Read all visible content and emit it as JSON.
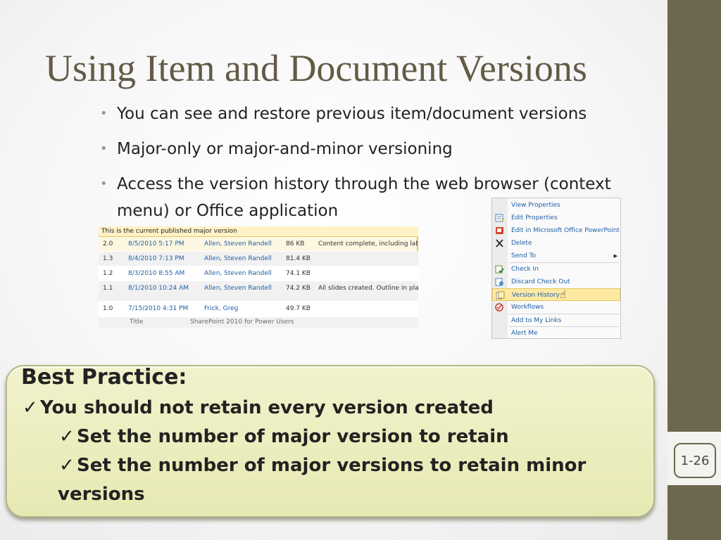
{
  "slide": {
    "title": "Using Item and Document Versions",
    "page_number": "1-26"
  },
  "bullets": [
    {
      "text": "You can see and restore previous item/document versions"
    },
    {
      "text": "Major-only or major-and-minor versioning"
    },
    {
      "text": "Access the version history through the web browser (context menu) or Office application"
    }
  ],
  "version_history": {
    "header": "This is the current published major version",
    "rows": [
      {
        "no": "2.0",
        "modified": "8/5/2010 5:17 PM",
        "modified_by": "Allen, Steven Randell",
        "size": "86 KB",
        "comments": "Content complete, including lab."
      },
      {
        "no": "1.3",
        "modified": "8/4/2010 7:13 PM",
        "modified_by": "Allen, Steven Randell",
        "size": "81.4 KB",
        "comments": ""
      },
      {
        "no": "1.2",
        "modified": "8/3/2010 8:55 AM",
        "modified_by": "Allen, Steven Randell",
        "size": "74.1 KB",
        "comments": ""
      },
      {
        "no": "1.1",
        "modified": "8/1/2010 10:24 AM",
        "modified_by": "Allen, Steven Randell",
        "size": "74.2 KB",
        "comments": "All slides created. Outline in place"
      },
      {
        "no": "1.0",
        "modified": "7/15/2010 4:31 PM",
        "modified_by": "Frick, Greg",
        "size": "49.7 KB",
        "comments": ""
      }
    ],
    "meta_label": "Title",
    "meta_value": "SharePoint 2010 for Power Users"
  },
  "context_menu": {
    "items": [
      {
        "label": "View Properties",
        "icon": "",
        "highlighted": false
      },
      {
        "label": "Edit Properties",
        "icon": "edit-icon",
        "highlighted": false
      },
      {
        "label": "Edit in Microsoft Office PowerPoint",
        "icon": "powerpoint-icon",
        "highlighted": false
      },
      {
        "label": "Delete",
        "icon": "delete-icon",
        "highlighted": false
      },
      {
        "label": "Send To",
        "icon": "",
        "highlighted": false,
        "submenu": true
      },
      {
        "label": "Check In",
        "icon": "check-in-icon",
        "highlighted": false
      },
      {
        "label": "Discard Check Out",
        "icon": "discard-icon",
        "highlighted": false
      },
      {
        "label": "Version History",
        "icon": "version-history-icon",
        "highlighted": true
      },
      {
        "label": "Workflows",
        "icon": "workflow-icon",
        "highlighted": false
      },
      {
        "label": "Add to My Links",
        "icon": "",
        "highlighted": false
      },
      {
        "label": "Alert Me",
        "icon": "",
        "highlighted": false
      }
    ]
  },
  "best_practice": {
    "heading": "Best Practice:",
    "check": "✓",
    "line1": "You should not retain every version created",
    "line2": "Set the number of major version to retain",
    "line3": "Set the number of major versions to retain minor",
    "line3_cont": "versions"
  },
  "colors": {
    "title": "#625b46",
    "sidebar": "#6e6750",
    "callout_fill": "#eceebf",
    "link": "#1f5fa8",
    "menu_highlight": "#fde9a2"
  }
}
